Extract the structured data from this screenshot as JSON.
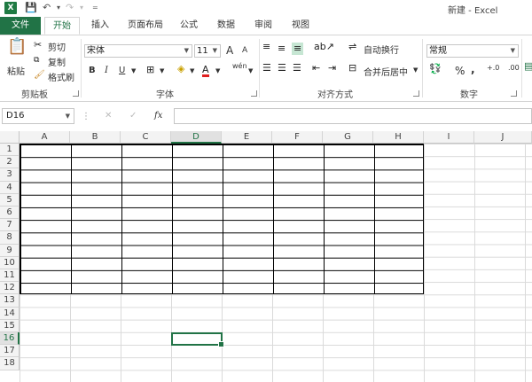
{
  "window": {
    "title": "新建 - Excel",
    "logo": "X"
  },
  "qat": {
    "save": "💾",
    "undo": "↶",
    "redo": "↷",
    "more": "="
  },
  "tabs": [
    "文件",
    "开始",
    "插入",
    "页面布局",
    "公式",
    "数据",
    "审阅",
    "视图"
  ],
  "clipboard": {
    "paste": "粘贴",
    "cut": "剪切",
    "copy": "复制",
    "format_painter": "格式刷",
    "label": "剪贴板"
  },
  "font": {
    "name": "宋体",
    "size": "11",
    "grow": "A",
    "shrink": "A",
    "bold": "B",
    "italic": "I",
    "underline": "U",
    "wen": "wén",
    "label": "字体"
  },
  "alignment": {
    "wrap": "自动换行",
    "merge": "合并后居中",
    "label": "对齐方式"
  },
  "number": {
    "format": "常规",
    "percent": "%",
    "comma": ",",
    "inc": "+.0",
    "dec": ".00",
    "label": "数字"
  },
  "formula_bar": {
    "name_box": "D16",
    "fx": "fx",
    "cancel": "✕",
    "enter": "✓"
  },
  "columns": [
    "A",
    "B",
    "C",
    "D",
    "E",
    "F",
    "G",
    "H",
    "I",
    "J"
  ],
  "rows": [
    "1",
    "2",
    "3",
    "4",
    "5",
    "6",
    "7",
    "8",
    "9",
    "10",
    "11",
    "12",
    "13",
    "14",
    "15",
    "16",
    "17",
    "18"
  ],
  "selected": {
    "col": "D",
    "row": "16"
  },
  "colors": {
    "accent": "#217346"
  }
}
